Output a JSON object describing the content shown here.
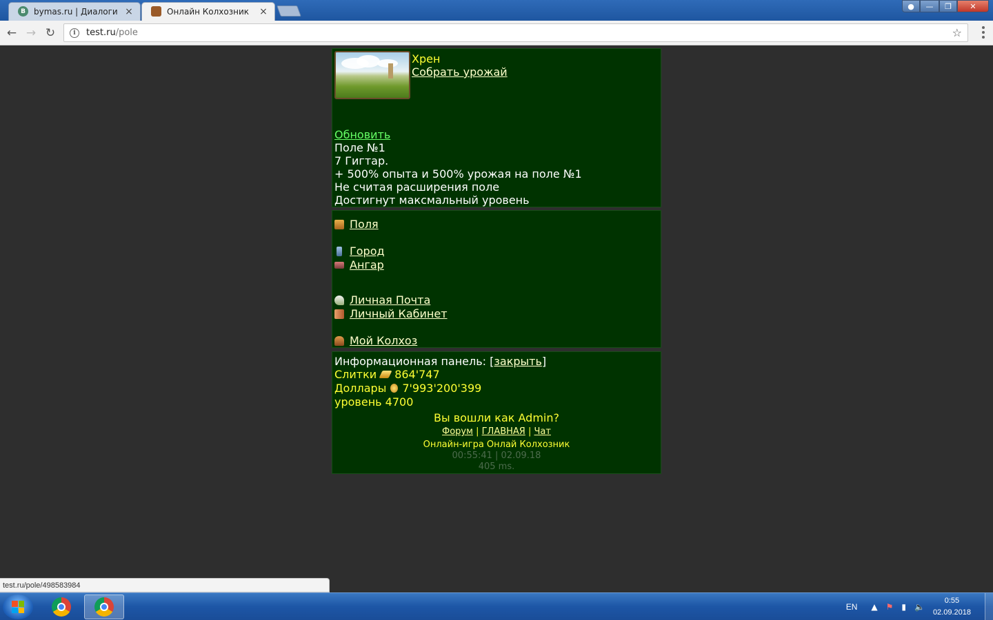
{
  "browser": {
    "tabs": [
      {
        "favicon": "В",
        "title": "bymas.ru | Диалоги",
        "close": "×"
      },
      {
        "favicon": "",
        "title": "Онлайн Колхозник",
        "close": "×"
      }
    ],
    "url_host": "test.ru",
    "url_path": "/pole",
    "status_url": "test.ru/pole/498583984"
  },
  "field": {
    "crop_name": "Хрен",
    "harvest_link": "Собрать урожай",
    "refresh_link": "Обновить",
    "info_lines": [
      "Поле №1",
      "7 Гигтар.",
      "+ 500% опыта и 500% урожая на поле №1",
      "Не считая расширения поле",
      "Достигнут максмальный уровень"
    ]
  },
  "menu": {
    "fields": "Поля",
    "city": "Город",
    "hangar": "Ангар",
    "mail": "Личная Почта",
    "cabinet": "Личный Кабинет",
    "kolkhoz": "Мой Колхоз"
  },
  "info_panel": {
    "title": "Информационная панель: [",
    "close_link": "закрыть",
    "title_end": "]",
    "bars_label": "Слитки",
    "bars_value": "864'747",
    "dollars_label": "Доллары",
    "dollars_value": "7'993'200'399",
    "level": "уровень 4700",
    "logged_in": "Вы вошли как Admin?",
    "forum": "Форум",
    "main": "ГЛАВНАЯ",
    "chat": "Чат",
    "sep": "|",
    "game_name": "Онлайн-игра Онлай Колхозник",
    "time": "00:55:41 | 02.09.18",
    "render_time": "405 ms."
  },
  "taskbar": {
    "lang": "EN",
    "clock_time": "0:55",
    "clock_date": "02.09.2018"
  },
  "colors": {
    "panel_bg": "#003300",
    "page_bg": "#2e2e2e",
    "link": "#ffffcc",
    "refresh_link": "#66ff66",
    "yellow_text": "#ffff33"
  }
}
